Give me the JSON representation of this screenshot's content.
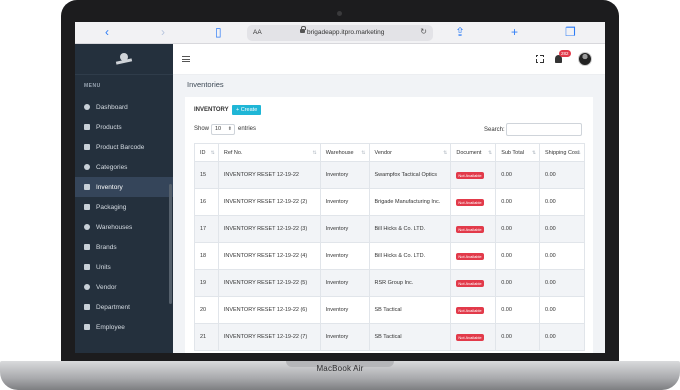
{
  "browser": {
    "aa_label": "AA",
    "url": "brigadeapp.itpro.marketing",
    "reload_glyph": "↻"
  },
  "sidebar": {
    "menu_heading": "MENU",
    "items": [
      {
        "label": "Dashboard",
        "icon": "gauge-icon"
      },
      {
        "label": "Products",
        "icon": "box-icon"
      },
      {
        "label": "Product Barcode",
        "icon": "barcode-icon"
      },
      {
        "label": "Categories",
        "icon": "folder-icon"
      },
      {
        "label": "Inventory",
        "icon": "clipboard-icon",
        "active": true
      },
      {
        "label": "Packaging",
        "icon": "package-icon"
      },
      {
        "label": "Warehouses",
        "icon": "warehouse-icon"
      },
      {
        "label": "Brands",
        "icon": "tag-icon"
      },
      {
        "label": "Units",
        "icon": "ruler-icon"
      },
      {
        "label": "Vendor",
        "icon": "truck-icon"
      },
      {
        "label": "Department",
        "icon": "sitemap-icon"
      },
      {
        "label": "Employee",
        "icon": "user-icon"
      }
    ]
  },
  "topbar": {
    "notification_count": "282"
  },
  "main": {
    "page_title": "Inventories",
    "card_title": "INVENTORY",
    "create_label": "+ Create",
    "show_label": "Show",
    "page_length": "10",
    "entries_label": "entries",
    "search_label": "Search:"
  },
  "table": {
    "columns": [
      "ID",
      "Ref No.",
      "Warehouse",
      "Vendor",
      "Document",
      "Sub Total",
      "Shipping Cost"
    ],
    "rows": [
      {
        "id": "15",
        "ref": "INVENTORY RESET 12-19-22",
        "warehouse": "Inventory",
        "vendor": "Swampfox Tactical Optics",
        "document": "Not Available",
        "subtotal": "0.00",
        "shipping": "0.00"
      },
      {
        "id": "16",
        "ref": "INVENTORY RESET 12-19-22 (2)",
        "warehouse": "Inventory",
        "vendor": "Brigade Manufacturing Inc.",
        "document": "Not Available",
        "subtotal": "0.00",
        "shipping": "0.00"
      },
      {
        "id": "17",
        "ref": "INVENTORY RESET 12-19-22 (3)",
        "warehouse": "Inventory",
        "vendor": "Bill Hicks & Co. LTD.",
        "document": "Not Available",
        "subtotal": "0.00",
        "shipping": "0.00"
      },
      {
        "id": "18",
        "ref": "INVENTORY RESET 12-19-22 (4)",
        "warehouse": "Inventory",
        "vendor": "Bill Hicks & Co. LTD.",
        "document": "Not Available",
        "subtotal": "0.00",
        "shipping": "0.00"
      },
      {
        "id": "19",
        "ref": "INVENTORY RESET 12-19-22 (5)",
        "warehouse": "Inventory",
        "vendor": "RSR Group Inc.",
        "document": "Not Available",
        "subtotal": "0.00",
        "shipping": "0.00"
      },
      {
        "id": "20",
        "ref": "INVENTORY RESET 12-19-22 (6)",
        "warehouse": "Inventory",
        "vendor": "SB Tactical",
        "document": "Not Available",
        "subtotal": "0.00",
        "shipping": "0.00"
      },
      {
        "id": "21",
        "ref": "INVENTORY RESET 12-19-22 (7)",
        "warehouse": "Inventory",
        "vendor": "SB Tactical",
        "document": "Not Available",
        "subtotal": "0.00",
        "shipping": "0.00"
      }
    ]
  },
  "device": {
    "label": "MacBook Air"
  },
  "colors": {
    "sidebar_bg": "#24303d",
    "accent": "#1fb6d6",
    "badge_red": "#e23a4a"
  }
}
